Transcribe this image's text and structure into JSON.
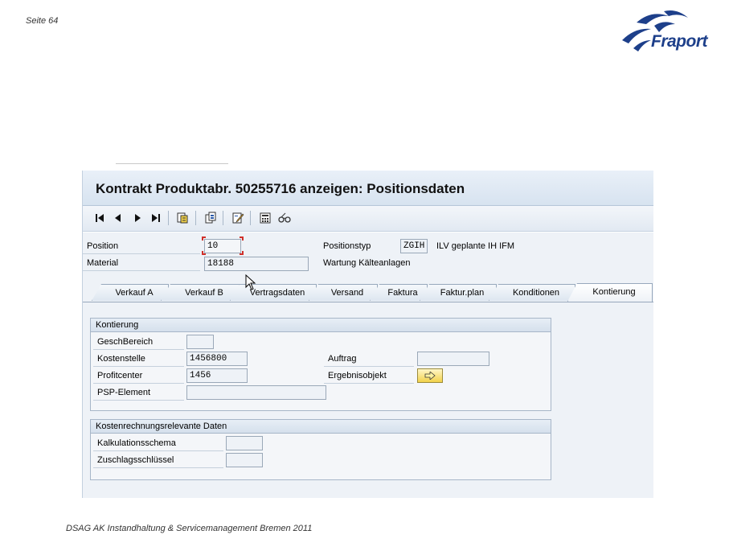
{
  "slide": {
    "page_label": "Seite 64",
    "footer": "DSAG AK Instandhaltung & Servicemanagement Bremen 2011",
    "logo_text": "Fraport"
  },
  "window": {
    "title": "Kontrakt Produktabr. 50255716 anzeigen: Positionsdaten"
  },
  "toolbar": {
    "icons": [
      "first-page-icon",
      "previous-page-icon",
      "next-page-icon",
      "last-page-icon",
      "overview-icon",
      "item-copy-icon",
      "edit-icon",
      "calculator-icon",
      "glasses-icon"
    ]
  },
  "header_fields": {
    "position_label": "Position",
    "position_value": "10",
    "material_label": "Material",
    "material_value": "18188",
    "material_desc": "Wartung Kälteanlagen",
    "positionstyp_label": "Positionstyp",
    "positionstyp_value": "ZGIH",
    "positionstyp_desc": "ILV geplante IH IFM"
  },
  "tabs": [
    "Verkauf A",
    "Verkauf B",
    "Vertragsdaten",
    "Versand",
    "Faktura",
    "Faktur.plan",
    "Konditionen",
    "Kontierung"
  ],
  "active_tab": "Kontierung",
  "kontierung": {
    "title": "Kontierung",
    "geschbereich_label": "GeschBereich",
    "geschbereich_value": "",
    "kostenstelle_label": "Kostenstelle",
    "kostenstelle_value": "1456800",
    "profitcenter_label": "Profitcenter",
    "profitcenter_value": "1456",
    "psp_label": "PSP-Element",
    "psp_value": "",
    "auftrag_label": "Auftrag",
    "auftrag_value": "",
    "ergebnisobjekt_label": "Ergebnisobjekt"
  },
  "kostenrechnung": {
    "title": "Kostenrechnungsrelevante Daten",
    "kalkulationsschema_label": "Kalkulationsschema",
    "kalkulationsschema_value": "",
    "zuschlagsschluessel_label": "Zuschlagsschlüssel",
    "zuschlagsschluessel_value": ""
  },
  "colors": {
    "accent_blue": "#1d3f8a",
    "focus_red": "#d0302a",
    "button_yellow": "#f2d24a"
  }
}
